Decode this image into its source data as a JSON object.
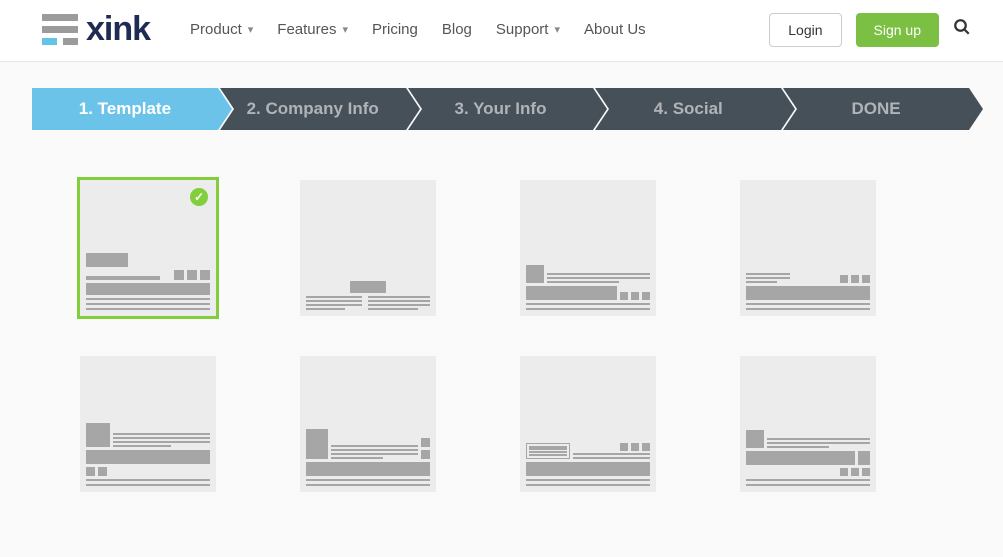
{
  "brand": {
    "name": "xink"
  },
  "nav": {
    "product": "Product",
    "features": "Features",
    "pricing": "Pricing",
    "blog": "Blog",
    "support": "Support",
    "about": "About Us"
  },
  "actions": {
    "login": "Login",
    "signup": "Sign up"
  },
  "steps": {
    "s1": "1. Template",
    "s2": "2. Company Info",
    "s3": "3. Your Info",
    "s4": "4. Social",
    "s5": "DONE"
  }
}
